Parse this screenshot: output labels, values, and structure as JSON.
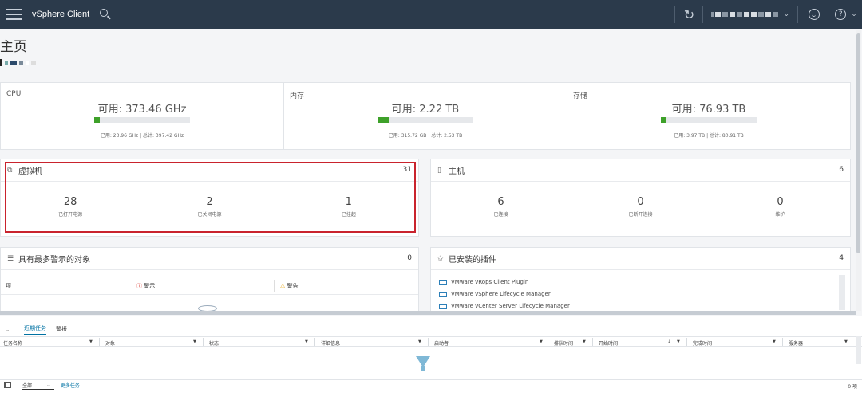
{
  "header": {
    "app_title": "vSphere Client"
  },
  "page": {
    "title": "主页"
  },
  "resources": [
    {
      "label": "CPU",
      "available": "可用: 373.46 GHz",
      "detail": "已用: 23.96 GHz | 总计: 397.42 GHz",
      "used_fraction": 0.06
    },
    {
      "label": "内存",
      "available": "可用: 2.22 TB",
      "detail": "已用: 315.72 GB | 总计: 2.53 TB",
      "used_fraction": 0.12
    },
    {
      "label": "存储",
      "available": "可用: 76.93 TB",
      "detail": "已用: 3.97 TB | 总计: 80.91 TB",
      "used_fraction": 0.05
    }
  ],
  "vms": {
    "title": "虚拟机",
    "count": "31",
    "stats": [
      {
        "value": "28",
        "label": "已打开电源"
      },
      {
        "value": "2",
        "label": "已关闭电源"
      },
      {
        "value": "1",
        "label": "已挂起"
      }
    ]
  },
  "hosts": {
    "title": "主机",
    "count": "6",
    "stats": [
      {
        "value": "6",
        "label": "已连接"
      },
      {
        "value": "0",
        "label": "已断开连接"
      },
      {
        "value": "0",
        "label": "维护"
      }
    ]
  },
  "alarms": {
    "title": "具有最多警示的对象",
    "count": "0",
    "col_item": "项",
    "col_alert": "警示",
    "col_warning": "警告"
  },
  "plugins": {
    "title": "已安装的插件",
    "count": "4",
    "items": [
      "VMware vRops Client Plugin",
      "VMware vSphere Lifecycle Manager",
      "VMware vCenter Server Lifecycle Manager"
    ]
  },
  "bottom": {
    "tab_recent": "近期任务",
    "tab_alarms": "警报",
    "columns": [
      "任务名称",
      "对象",
      "状态",
      "详细信息",
      "启动者",
      "排队时间",
      "开始时间",
      "完成时间",
      "服务器"
    ],
    "filter_value": "全部",
    "more_tasks": "更多任务",
    "item_count": "0 项"
  },
  "colors": {
    "topbar": "#2b3a4b",
    "bar_fill": "#3ea12a",
    "highlight": "#c9232d",
    "link": "#0072a3"
  }
}
